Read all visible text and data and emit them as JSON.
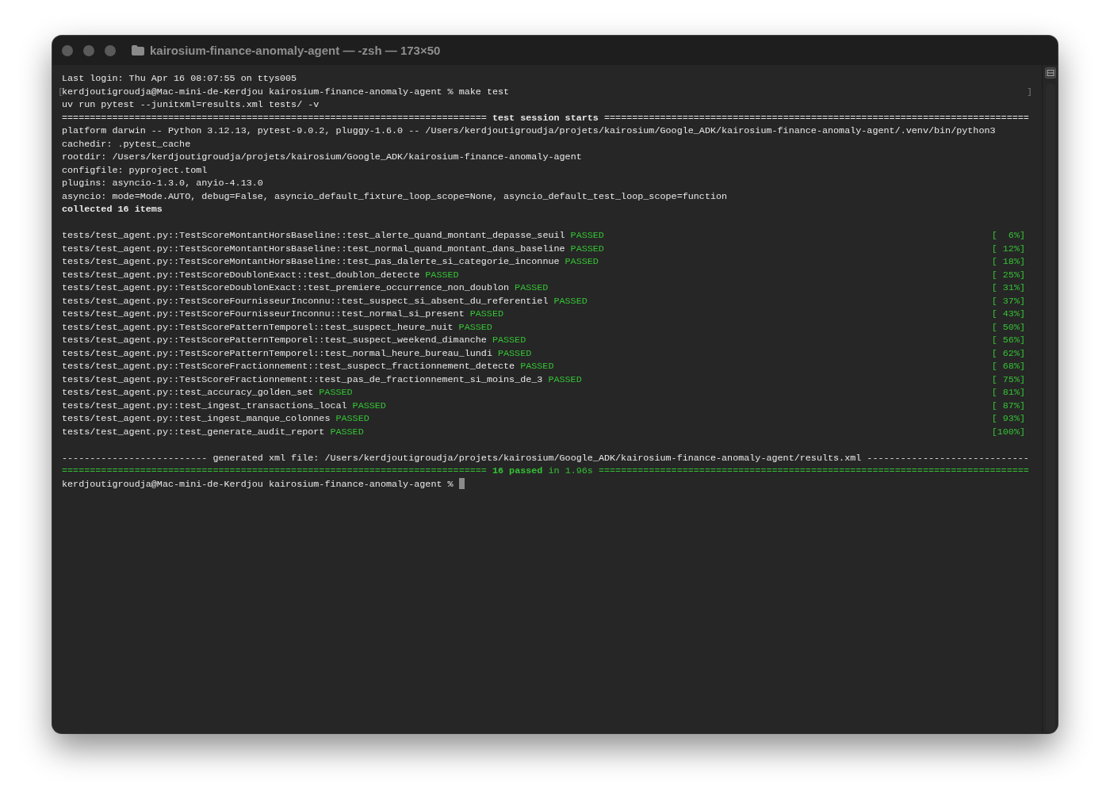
{
  "window": {
    "title": "kairosium-finance-anomaly-agent — -zsh — 173×50"
  },
  "terminal": {
    "lines": [
      {
        "kind": "text",
        "text": "Last login: Thu Apr 16 08:07:55 on ttys005"
      },
      {
        "kind": "prompt",
        "mark_left": "[",
        "text": "kerdjoutigroudja@Mac-mini-de-Kerdjou kairosium-finance-anomaly-agent % make test",
        "mark_right": "]"
      },
      {
        "kind": "text",
        "text": "uv run pytest --junitxml=results.xml tests/ -v"
      },
      {
        "kind": "rule",
        "success": false,
        "text": "============================================================================ **test session starts** ============================================================================"
      },
      {
        "kind": "text",
        "text": "platform darwin -- Python 3.12.13, pytest-9.0.2, pluggy-1.6.0 -- /Users/kerdjoutigroudja/projets/kairosium/Google_ADK/kairosium-finance-anomaly-agent/.venv/bin/python3"
      },
      {
        "kind": "text",
        "text": "cachedir: .pytest_cache"
      },
      {
        "kind": "text",
        "text": "rootdir: /Users/kerdjoutigroudja/projets/kairosium/Google_ADK/kairosium-finance-anomaly-agent"
      },
      {
        "kind": "text",
        "text": "configfile: pyproject.toml"
      },
      {
        "kind": "text",
        "text": "plugins: asyncio-1.3.0, anyio-4.13.0"
      },
      {
        "kind": "text",
        "text": "asyncio: mode=Mode.AUTO, debug=False, asyncio_default_fixture_loop_scope=None, asyncio_default_test_loop_scope=function"
      },
      {
        "kind": "text",
        "text": "collected 16 items",
        "bold": true
      },
      {
        "kind": "blank"
      },
      {
        "kind": "result",
        "test": "tests/test_agent.py::TestScoreMontantHorsBaseline::test_alerte_quand_montant_depasse_seuil",
        "status": "PASSED",
        "progress": "[  6%]"
      },
      {
        "kind": "result",
        "test": "tests/test_agent.py::TestScoreMontantHorsBaseline::test_normal_quand_montant_dans_baseline",
        "status": "PASSED",
        "progress": "[ 12%]"
      },
      {
        "kind": "result",
        "test": "tests/test_agent.py::TestScoreMontantHorsBaseline::test_pas_dalerte_si_categorie_inconnue",
        "status": "PASSED",
        "progress": "[ 18%]"
      },
      {
        "kind": "result",
        "test": "tests/test_agent.py::TestScoreDoublonExact::test_doublon_detecte",
        "status": "PASSED",
        "progress": "[ 25%]"
      },
      {
        "kind": "result",
        "test": "tests/test_agent.py::TestScoreDoublonExact::test_premiere_occurrence_non_doublon",
        "status": "PASSED",
        "progress": "[ 31%]"
      },
      {
        "kind": "result",
        "test": "tests/test_agent.py::TestScoreFournisseurInconnu::test_suspect_si_absent_du_referentiel",
        "status": "PASSED",
        "progress": "[ 37%]"
      },
      {
        "kind": "result",
        "test": "tests/test_agent.py::TestScoreFournisseurInconnu::test_normal_si_present",
        "status": "PASSED",
        "progress": "[ 43%]"
      },
      {
        "kind": "result",
        "test": "tests/test_agent.py::TestScorePatternTemporel::test_suspect_heure_nuit",
        "status": "PASSED",
        "progress": "[ 50%]"
      },
      {
        "kind": "result",
        "test": "tests/test_agent.py::TestScorePatternTemporel::test_suspect_weekend_dimanche",
        "status": "PASSED",
        "progress": "[ 56%]"
      },
      {
        "kind": "result",
        "test": "tests/test_agent.py::TestScorePatternTemporel::test_normal_heure_bureau_lundi",
        "status": "PASSED",
        "progress": "[ 62%]"
      },
      {
        "kind": "result",
        "test": "tests/test_agent.py::TestScoreFractionnement::test_suspect_fractionnement_detecte",
        "status": "PASSED",
        "progress": "[ 68%]"
      },
      {
        "kind": "result",
        "test": "tests/test_agent.py::TestScoreFractionnement::test_pas_de_fractionnement_si_moins_de_3",
        "status": "PASSED",
        "progress": "[ 75%]"
      },
      {
        "kind": "result",
        "test": "tests/test_agent.py::test_accuracy_golden_set",
        "status": "PASSED",
        "progress": "[ 81%]"
      },
      {
        "kind": "result",
        "test": "tests/test_agent.py::test_ingest_transactions_local",
        "status": "PASSED",
        "progress": "[ 87%]"
      },
      {
        "kind": "result",
        "test": "tests/test_agent.py::test_ingest_manque_colonnes",
        "status": "PASSED",
        "progress": "[ 93%]"
      },
      {
        "kind": "result",
        "test": "tests/test_agent.py::test_generate_audit_report",
        "status": "PASSED",
        "progress": "[100%]"
      },
      {
        "kind": "blank"
      },
      {
        "kind": "rule",
        "success": false,
        "text": "-------------------------- generated xml file: /Users/kerdjoutigroudja/projets/kairosium/Google_ADK/kairosium-finance-anomaly-agent/results.xml -----------------------------"
      },
      {
        "kind": "rule",
        "success": true,
        "text": "============================================================================ **16 passed** in 1.96s ============================================================================="
      },
      {
        "kind": "prompt",
        "text": "kerdjoutigroudja@Mac-mini-de-Kerdjou kairosium-finance-anomaly-agent %",
        "cursor": true
      }
    ]
  }
}
